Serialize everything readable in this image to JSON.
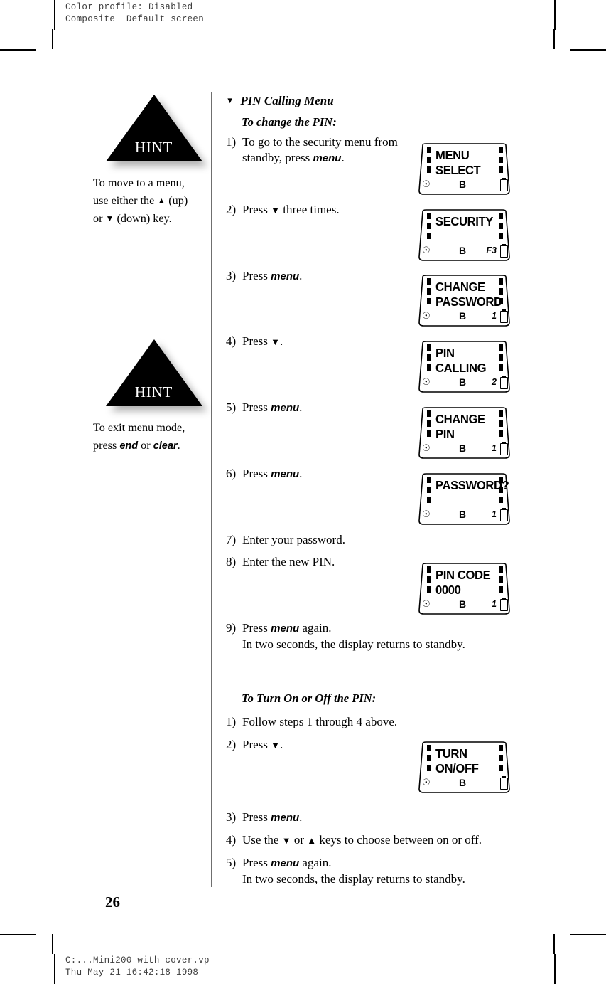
{
  "proof": {
    "header": "Color profile: Disabled\nComposite  Default screen",
    "footer": "C:...Mini200 with cover.vp\nThu May 21 16:42:18 1998"
  },
  "page_number": "26",
  "hints": [
    {
      "label": "HINT",
      "line1": "To move to a menu,",
      "line2_a": "use either the ",
      "line2_up": "▲",
      "line2_b": " (up)",
      "line3_dn": "▼",
      "line3_a": "or ",
      "line3_b": " (down) key."
    },
    {
      "label": "HINT",
      "line1": "To exit menu mode,",
      "line2_a": "press ",
      "line2_kw1": "end",
      "line2_mid": " or ",
      "line2_kw2": "clear",
      "line2_end": "."
    }
  ],
  "section": {
    "marker": "▼",
    "title": "PIN Calling Menu",
    "subtitle": "To change the PIN:"
  },
  "steps_change_pin": [
    {
      "num": "1)",
      "text_a": "To go to the security menu from standby, press ",
      "keyword": "menu",
      "text_b": "."
    },
    {
      "num": "2)",
      "text_a": "Press ",
      "arrow": "▼",
      "text_b": " three times."
    },
    {
      "num": "3)",
      "text_a": "Press ",
      "keyword": "menu",
      "text_b": "."
    },
    {
      "num": "4)",
      "text_a": "Press ",
      "arrow": "▼",
      "text_b": "."
    },
    {
      "num": "5)",
      "text_a": "Press ",
      "keyword": "menu",
      "text_b": "."
    },
    {
      "num": "6)",
      "text_a": "Press ",
      "keyword": "menu",
      "text_b": "."
    },
    {
      "num": "7)",
      "text_a": "Enter your password."
    },
    {
      "num": "8)",
      "text_a": "Enter the new PIN."
    },
    {
      "num": "9)",
      "text_a": "Press ",
      "keyword": "menu",
      "text_b": " again.",
      "continuation": "In two seconds, the display returns to standby."
    }
  ],
  "section2": {
    "subtitle": "To Turn On or Off the PIN:"
  },
  "steps_turn_on_off": [
    {
      "num": "1)",
      "text_a": "Follow steps 1 through 4 above."
    },
    {
      "num": "2)",
      "text_a": "Press ",
      "arrow": "▼",
      "text_b": "."
    },
    {
      "num": "3)",
      "text_a": "Press ",
      "keyword": "menu",
      "text_b": "."
    },
    {
      "num": "4)",
      "text_a": "Use the ",
      "arrow": "▼",
      "text_mid": " or ",
      "arrow2": "▲",
      "text_b": " keys to choose between on or off."
    },
    {
      "num": "5)",
      "text_a": "Press ",
      "keyword": "menu",
      "text_b": " again.",
      "continuation": "In two seconds, the display returns to standby."
    }
  ],
  "lcd_screens": [
    {
      "line1": "MENU",
      "line2": "SELECT",
      "status_b": "B",
      "index": ""
    },
    {
      "line1": "SECURITY",
      "line2": "",
      "status_b": "B",
      "index": "F3"
    },
    {
      "line1": "CHANGE",
      "line2": "PASSWORD",
      "status_b": "B",
      "index": "1"
    },
    {
      "line1": "PIN",
      "line2": "CALLING",
      "status_b": "B",
      "index": "2"
    },
    {
      "line1": "CHANGE",
      "line2": "PIN",
      "status_b": "B",
      "index": "1"
    },
    {
      "line1": "PASSWORD?",
      "line2": "",
      "status_b": "B",
      "index": "1"
    },
    {
      "line1": "PIN CODE",
      "line2": "0000",
      "status_b": "B",
      "index": "1"
    },
    {
      "line1": "TURN",
      "line2": "ON/OFF",
      "status_b": "B",
      "index": ""
    }
  ],
  "colors": {
    "ink": "#000000",
    "paper": "#ffffff",
    "rule": "#6f6f6f",
    "proof_ink": "#3d3d3d"
  }
}
